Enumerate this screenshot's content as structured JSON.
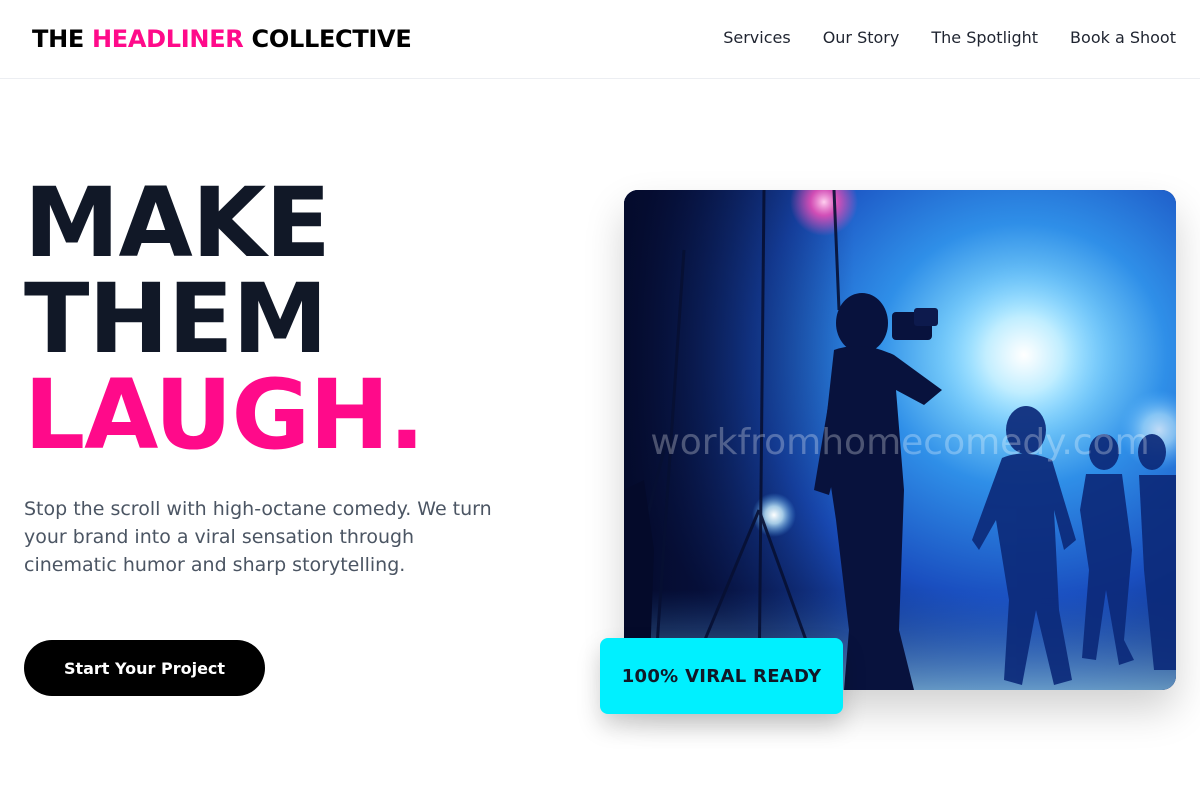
{
  "header": {
    "logo_part1": "THE ",
    "logo_accent": "HEADLINER",
    "logo_part2": " COLLECTIVE",
    "nav": [
      "Services",
      "Our Story",
      "The Spotlight",
      "Book a Shoot"
    ]
  },
  "hero": {
    "title_line1": "MAKE",
    "title_line2": "THEM",
    "title_line3": "LAUGH.",
    "copy": "Stop the scroll with high-octane comedy. We turn your brand into a viral sensation through cinematic humor and sharp storytelling.",
    "cta_label": "Start Your Project",
    "image_watermark": "workfromhomecomedy.com",
    "badge_text": "100% VIRAL READY"
  },
  "colors": {
    "accent_pink": "#ff0a8a",
    "accent_cyan": "#00f0ff",
    "text_dark": "#111827",
    "button_bg": "#000000"
  }
}
